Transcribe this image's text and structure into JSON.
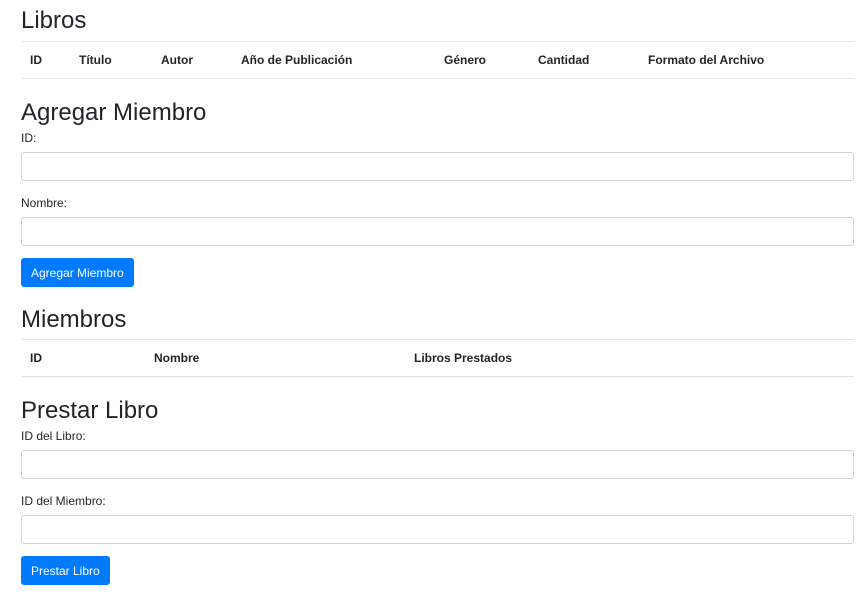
{
  "books": {
    "title": "Libros",
    "columns": [
      "ID",
      "Título",
      "Autor",
      "Año de Publicación",
      "Género",
      "Cantidad",
      "Formato del Archivo"
    ]
  },
  "add_member": {
    "title": "Agregar Miembro",
    "id_label": "ID:",
    "id_value": "",
    "name_label": "Nombre:",
    "name_value": "",
    "button_label": "Agregar Miembro"
  },
  "members": {
    "title": "Miembros",
    "columns": [
      "ID",
      "Nombre",
      "Libros Prestados"
    ]
  },
  "lend_book": {
    "title": "Prestar Libro",
    "book_id_label": "ID del Libro:",
    "book_id_value": "",
    "member_id_label": "ID del Miembro:",
    "member_id_value": "",
    "button_label": "Prestar Libro"
  },
  "colors": {
    "primary": "#007bff",
    "border": "#dee2e6",
    "input_border": "#ced4da"
  }
}
